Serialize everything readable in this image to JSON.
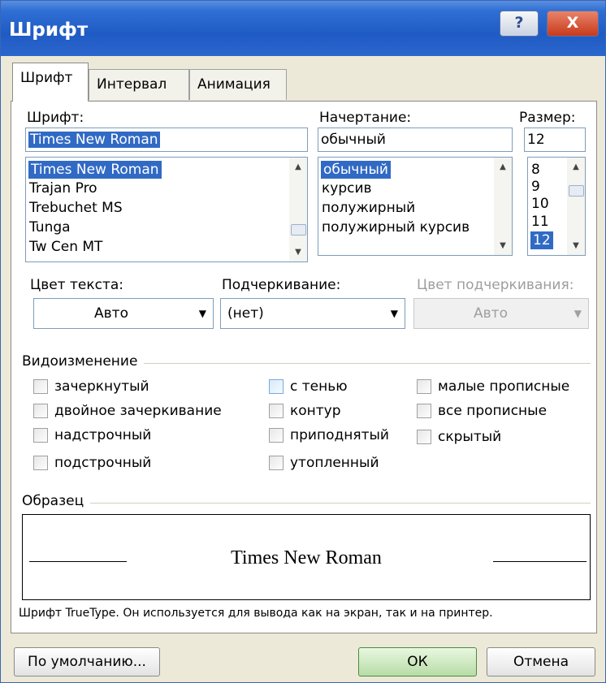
{
  "title": "Шрифт",
  "titlebar": {
    "help": "?",
    "close": "X"
  },
  "tabs": [
    "Шрифт",
    "Интервал",
    "Анимация"
  ],
  "font": {
    "label": "Шрифт:",
    "value": "Times New Roman",
    "items": [
      "Times New Roman",
      "Trajan Pro",
      "Trebuchet MS",
      "Tunga",
      "Tw Cen MT"
    ],
    "selected_index": 0
  },
  "style": {
    "label": "Начертание:",
    "value": "обычный",
    "items": [
      "обычный",
      "курсив",
      "полужирный",
      "полужирный курсив"
    ],
    "selected_index": 0
  },
  "size": {
    "label": "Размер:",
    "value": "12",
    "items": [
      "8",
      "9",
      "10",
      "11",
      "12"
    ],
    "selected_index": 4
  },
  "text_color": {
    "label": "Цвет текста:",
    "value": "Авто"
  },
  "underline": {
    "label": "Подчеркивание:",
    "value": "(нет)"
  },
  "underline_color": {
    "label": "Цвет подчеркивания:",
    "value": "Авто",
    "enabled": false
  },
  "effects": {
    "group": "Видоизменение",
    "col1": [
      "зачеркнутый",
      "двойное зачеркивание",
      "надстрочный",
      "подстрочный"
    ],
    "col2": [
      "с тенью",
      "контур",
      "приподнятый",
      "утопленный"
    ],
    "col3": [
      "малые прописные",
      "все прописные",
      "скрытый"
    ]
  },
  "sample": {
    "group": "Образец",
    "text": "Times New Roman",
    "note": "Шрифт TrueType. Он используется для вывода как на экран, так и на принтер."
  },
  "buttons": {
    "default": "По умолчанию...",
    "ok": "ОК",
    "cancel": "Отмена"
  }
}
